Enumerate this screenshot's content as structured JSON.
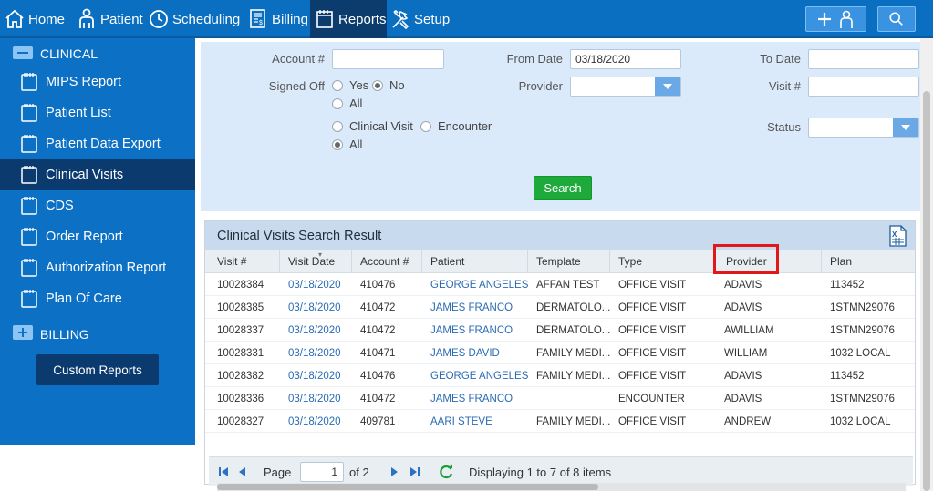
{
  "nav": {
    "items": [
      {
        "label": "Home",
        "icon": "home-icon"
      },
      {
        "label": "Patient",
        "icon": "patient-icon"
      },
      {
        "label": "Scheduling",
        "icon": "clock-icon"
      },
      {
        "label": "Billing",
        "icon": "billing-icon"
      },
      {
        "label": "Reports",
        "icon": "calendar-icon",
        "active": true
      },
      {
        "label": "Setup",
        "icon": "tools-icon"
      }
    ],
    "add_patient_icon": "add-patient-icon",
    "search_icon": "search-icon"
  },
  "sidebar": {
    "clinical_section": "CLINICAL",
    "items": [
      {
        "label": "MIPS Report"
      },
      {
        "label": "Patient List"
      },
      {
        "label": "Patient Data Export"
      },
      {
        "label": "Clinical Visits",
        "active": true
      },
      {
        "label": "CDS"
      },
      {
        "label": "Order Report"
      },
      {
        "label": "Authorization Report"
      },
      {
        "label": "Plan Of Care"
      }
    ],
    "billing_section": "BILLING",
    "custom_reports_button": "Custom Reports"
  },
  "filters": {
    "account_label": "Account #",
    "account_value": "",
    "from_date_label": "From Date",
    "from_date_value": "03/18/2020",
    "to_date_label": "To Date",
    "to_date_value": "",
    "signed_off_label": "Signed Off",
    "signed_off_options": [
      "Yes",
      "No",
      "All"
    ],
    "signed_off_selected": "No",
    "provider_label": "Provider",
    "provider_value": "",
    "visit_label": "Visit #",
    "visit_value": "",
    "type_options": [
      "Clinical Visit",
      "Encounter",
      "All"
    ],
    "type_selected": "All",
    "status_label": "Status",
    "status_value": "",
    "search_button": "Search"
  },
  "results": {
    "title": "Clinical Visits Search Result",
    "columns": [
      "Visit #",
      "Visit Date",
      "Account #",
      "Patient",
      "Template",
      "Type",
      "Provider",
      "Plan"
    ],
    "rows": [
      [
        "10028384",
        "03/18/2020",
        "410476",
        "GEORGE ANGELES",
        "AFFAN TEST",
        "OFFICE VISIT",
        "ADAVIS",
        "113452"
      ],
      [
        "10028385",
        "03/18/2020",
        "410472",
        "JAMES FRANCO",
        "DERMATOLO...",
        "OFFICE VISIT",
        "ADAVIS",
        "1STMN29076"
      ],
      [
        "10028337",
        "03/18/2020",
        "410472",
        "JAMES FRANCO",
        "DERMATOLO...",
        "OFFICE VISIT",
        "AWILLIAM",
        "1STMN29076"
      ],
      [
        "10028331",
        "03/18/2020",
        "410471",
        "JAMES DAVID",
        "FAMILY MEDI...",
        "OFFICE VISIT",
        "WILLIAM",
        "1032 LOCAL"
      ],
      [
        "10028382",
        "03/18/2020",
        "410476",
        "GEORGE ANGELES",
        "FAMILY MEDI...",
        "OFFICE VISIT",
        "ADAVIS",
        "113452"
      ],
      [
        "10028336",
        "03/18/2020",
        "410472",
        "JAMES FRANCO",
        "",
        "ENCOUNTER",
        "ADAVIS",
        "1STMN29076"
      ],
      [
        "10028327",
        "03/18/2020",
        "409781",
        "AARI STEVE",
        "FAMILY MEDI...",
        "OFFICE VISIT",
        "ANDREW",
        "1032 LOCAL"
      ]
    ],
    "highlighted_column": "Provider",
    "highlight_color": "#e21818"
  },
  "pager": {
    "page_label": "Page",
    "page_value": "1",
    "of_label": "of 2",
    "status": "Displaying 1 to 7 of 8 items"
  },
  "colors": {
    "nav_bg": "#0a6fc1",
    "sidebar_bg": "#0c70c4",
    "active_bg": "#0b3a6e",
    "filter_bg": "#dbeafa",
    "search_button": "#1daa3a",
    "link": "#2a6bb3"
  }
}
